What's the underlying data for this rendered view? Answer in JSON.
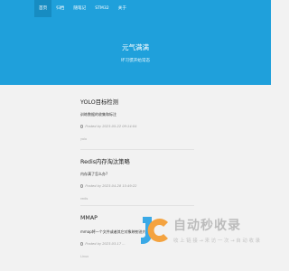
{
  "nav": {
    "items": [
      {
        "label": "首页",
        "active": true
      },
      {
        "label": "归档",
        "active": false
      },
      {
        "label": "随笔记",
        "active": false
      },
      {
        "label": "STM32",
        "active": false
      },
      {
        "label": "关于",
        "active": false
      }
    ]
  },
  "hero": {
    "title": "元气满满",
    "subtitle": "坏习惯开始常态"
  },
  "posts": [
    {
      "title": "YOLO目标检测",
      "excerpt": "训练数据的收集和标注",
      "meta": "Posted by 2023-05-22 09:14:04",
      "tag": "yolo"
    },
    {
      "title": "Redis内存淘汰策略",
      "excerpt": "内存满了怎么办?",
      "meta": "Posted by 2023-04-28 15:49:22",
      "tag": "redis"
    },
    {
      "title": "MMAP",
      "excerpt": "mmap将一个文件或者其它对象映射进内存",
      "meta": "Posted by 2023-03-17 ...",
      "tag": "Linux"
    }
  ],
  "watermark": {
    "title": "自动秒收录",
    "subtitle": "收 上 链 接 → 来 访 一 次 → 自 动 收 录",
    "logo_icon": "jc-logo-icon",
    "colors": {
      "blue": "#3aa9e6",
      "orange": "#f4a340"
    }
  },
  "colors": {
    "brand": "#1fa0db",
    "nav_active": "#178cc2",
    "page_bg": "#f2f2f2"
  }
}
